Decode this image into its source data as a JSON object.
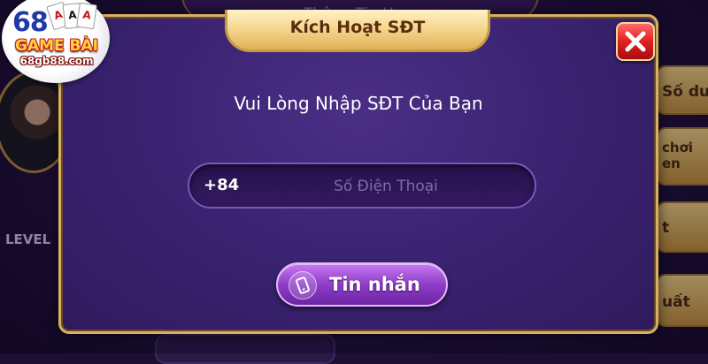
{
  "logo": {
    "number": "68",
    "game_text": "GAME BÀI",
    "url_text": "68gb88.com",
    "cards": [
      "A",
      "A",
      "A"
    ]
  },
  "background": {
    "panel_title": "Thông Tin User",
    "level_label": "LEVEL",
    "side_buttons": [
      "Số dư",
      "chơi\nen",
      "t",
      "uất"
    ]
  },
  "modal": {
    "title": "Kích Hoạt SĐT",
    "prompt": "Vui Lòng Nhập SĐT Của Bạn",
    "country_code": "+84",
    "phone_placeholder": "Số Điện Thoại",
    "phone_value": "",
    "submit_label": "Tin nhắn",
    "close_icon": "close-x-icon",
    "submit_icon": "phone-icon"
  },
  "colors": {
    "modal_border": "#d7b063",
    "modal_bg": "#3c2473",
    "close_red": "#e02020",
    "submit_purple": "#8e3dc8"
  }
}
